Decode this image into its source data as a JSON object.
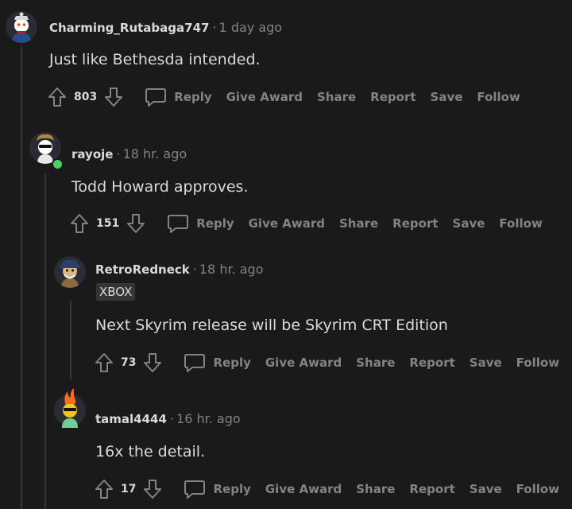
{
  "comments": [
    {
      "author": "Charming_Rutabaga747",
      "time": "1 day ago",
      "text": "Just like Bethesda intended.",
      "votes": "803",
      "online": false
    },
    {
      "author": "rayoje",
      "time": "18 hr. ago",
      "text": "Todd Howard approves.",
      "votes": "151",
      "online": true
    },
    {
      "author": "RetroRedneck",
      "time": "18 hr. ago",
      "flair": "XBOX",
      "text": "Next Skyrim release will be Skyrim CRT Edition",
      "votes": "73",
      "online": false
    },
    {
      "author": "tamal4444",
      "time": "16 hr. ago",
      "text": "16x the detail.",
      "votes": "17",
      "online": false
    }
  ],
  "separator": "·",
  "actions": {
    "reply": "Reply",
    "give_award": "Give Award",
    "share": "Share",
    "report": "Report",
    "save": "Save",
    "follow": "Follow"
  },
  "icons": {
    "upvote": "arrow-up-icon",
    "downvote": "arrow-down-icon",
    "reply": "speech-bubble-icon"
  },
  "colors": {
    "background": "#1a1a1b",
    "text": "#d7dadc",
    "muted": "#818384",
    "thread_line": "#343536",
    "online": "#46d160"
  }
}
